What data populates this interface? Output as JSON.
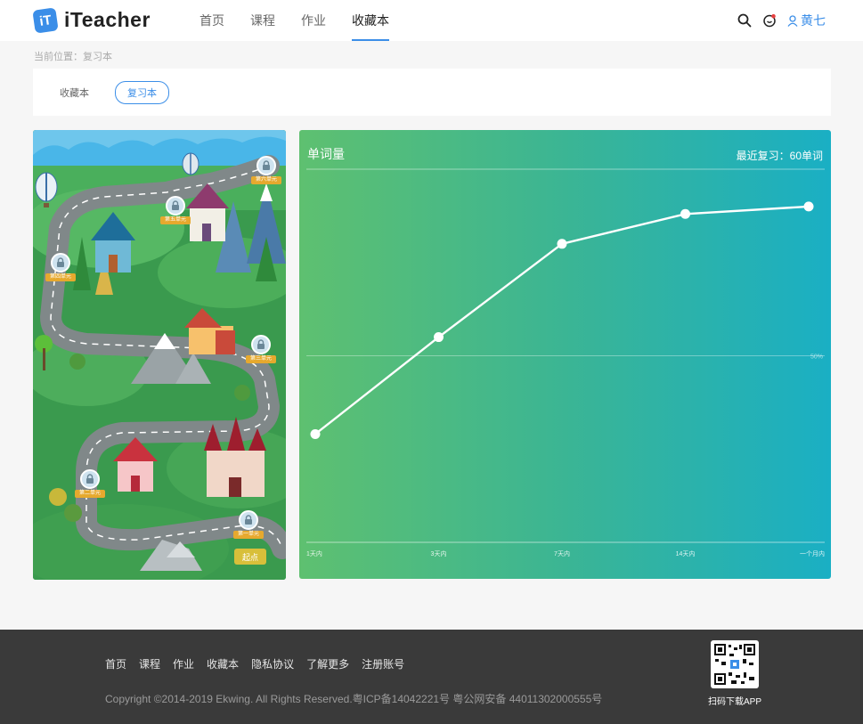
{
  "header": {
    "logo_mark": "iT",
    "logo_text": "iTeacher",
    "nav": [
      {
        "label": "首页"
      },
      {
        "label": "课程"
      },
      {
        "label": "作业"
      },
      {
        "label": "收藏本",
        "active": true
      }
    ],
    "user_name": "黄七",
    "icons": [
      "search-icon",
      "notification-icon",
      "user-icon"
    ],
    "accent_color": "#3b8ee8"
  },
  "breadcrumb": "当前位置：复习本",
  "tabs": [
    {
      "label": "收藏本"
    },
    {
      "label": "复习本",
      "active": true
    }
  ],
  "map": {
    "units": [
      "第一单元",
      "第二单元",
      "第三单元",
      "第四单元",
      "第五单元",
      "第六单元"
    ],
    "start_label": "起点"
  },
  "chart": {
    "title": "单词量",
    "recent_review": "最近复习：60单词",
    "mid_label": "50%"
  },
  "chart_data": {
    "type": "line",
    "categories": [
      "1天内",
      "3天内",
      "7天内",
      "14天内",
      "一个月内"
    ],
    "values": [
      29,
      55,
      80,
      88,
      90
    ],
    "ylim": [
      0,
      100
    ],
    "grid": true
  },
  "footer": {
    "links": [
      "首页",
      "课程",
      "作业",
      "收藏本",
      "隐私协议",
      "了解更多",
      "注册账号"
    ],
    "copyright": "Copyright ©2014-2019 Ekwing. All Rights Reserved.粤ICP备14042221号 粤公网安备 44011302000555号",
    "qr_caption": "扫码下载APP"
  }
}
